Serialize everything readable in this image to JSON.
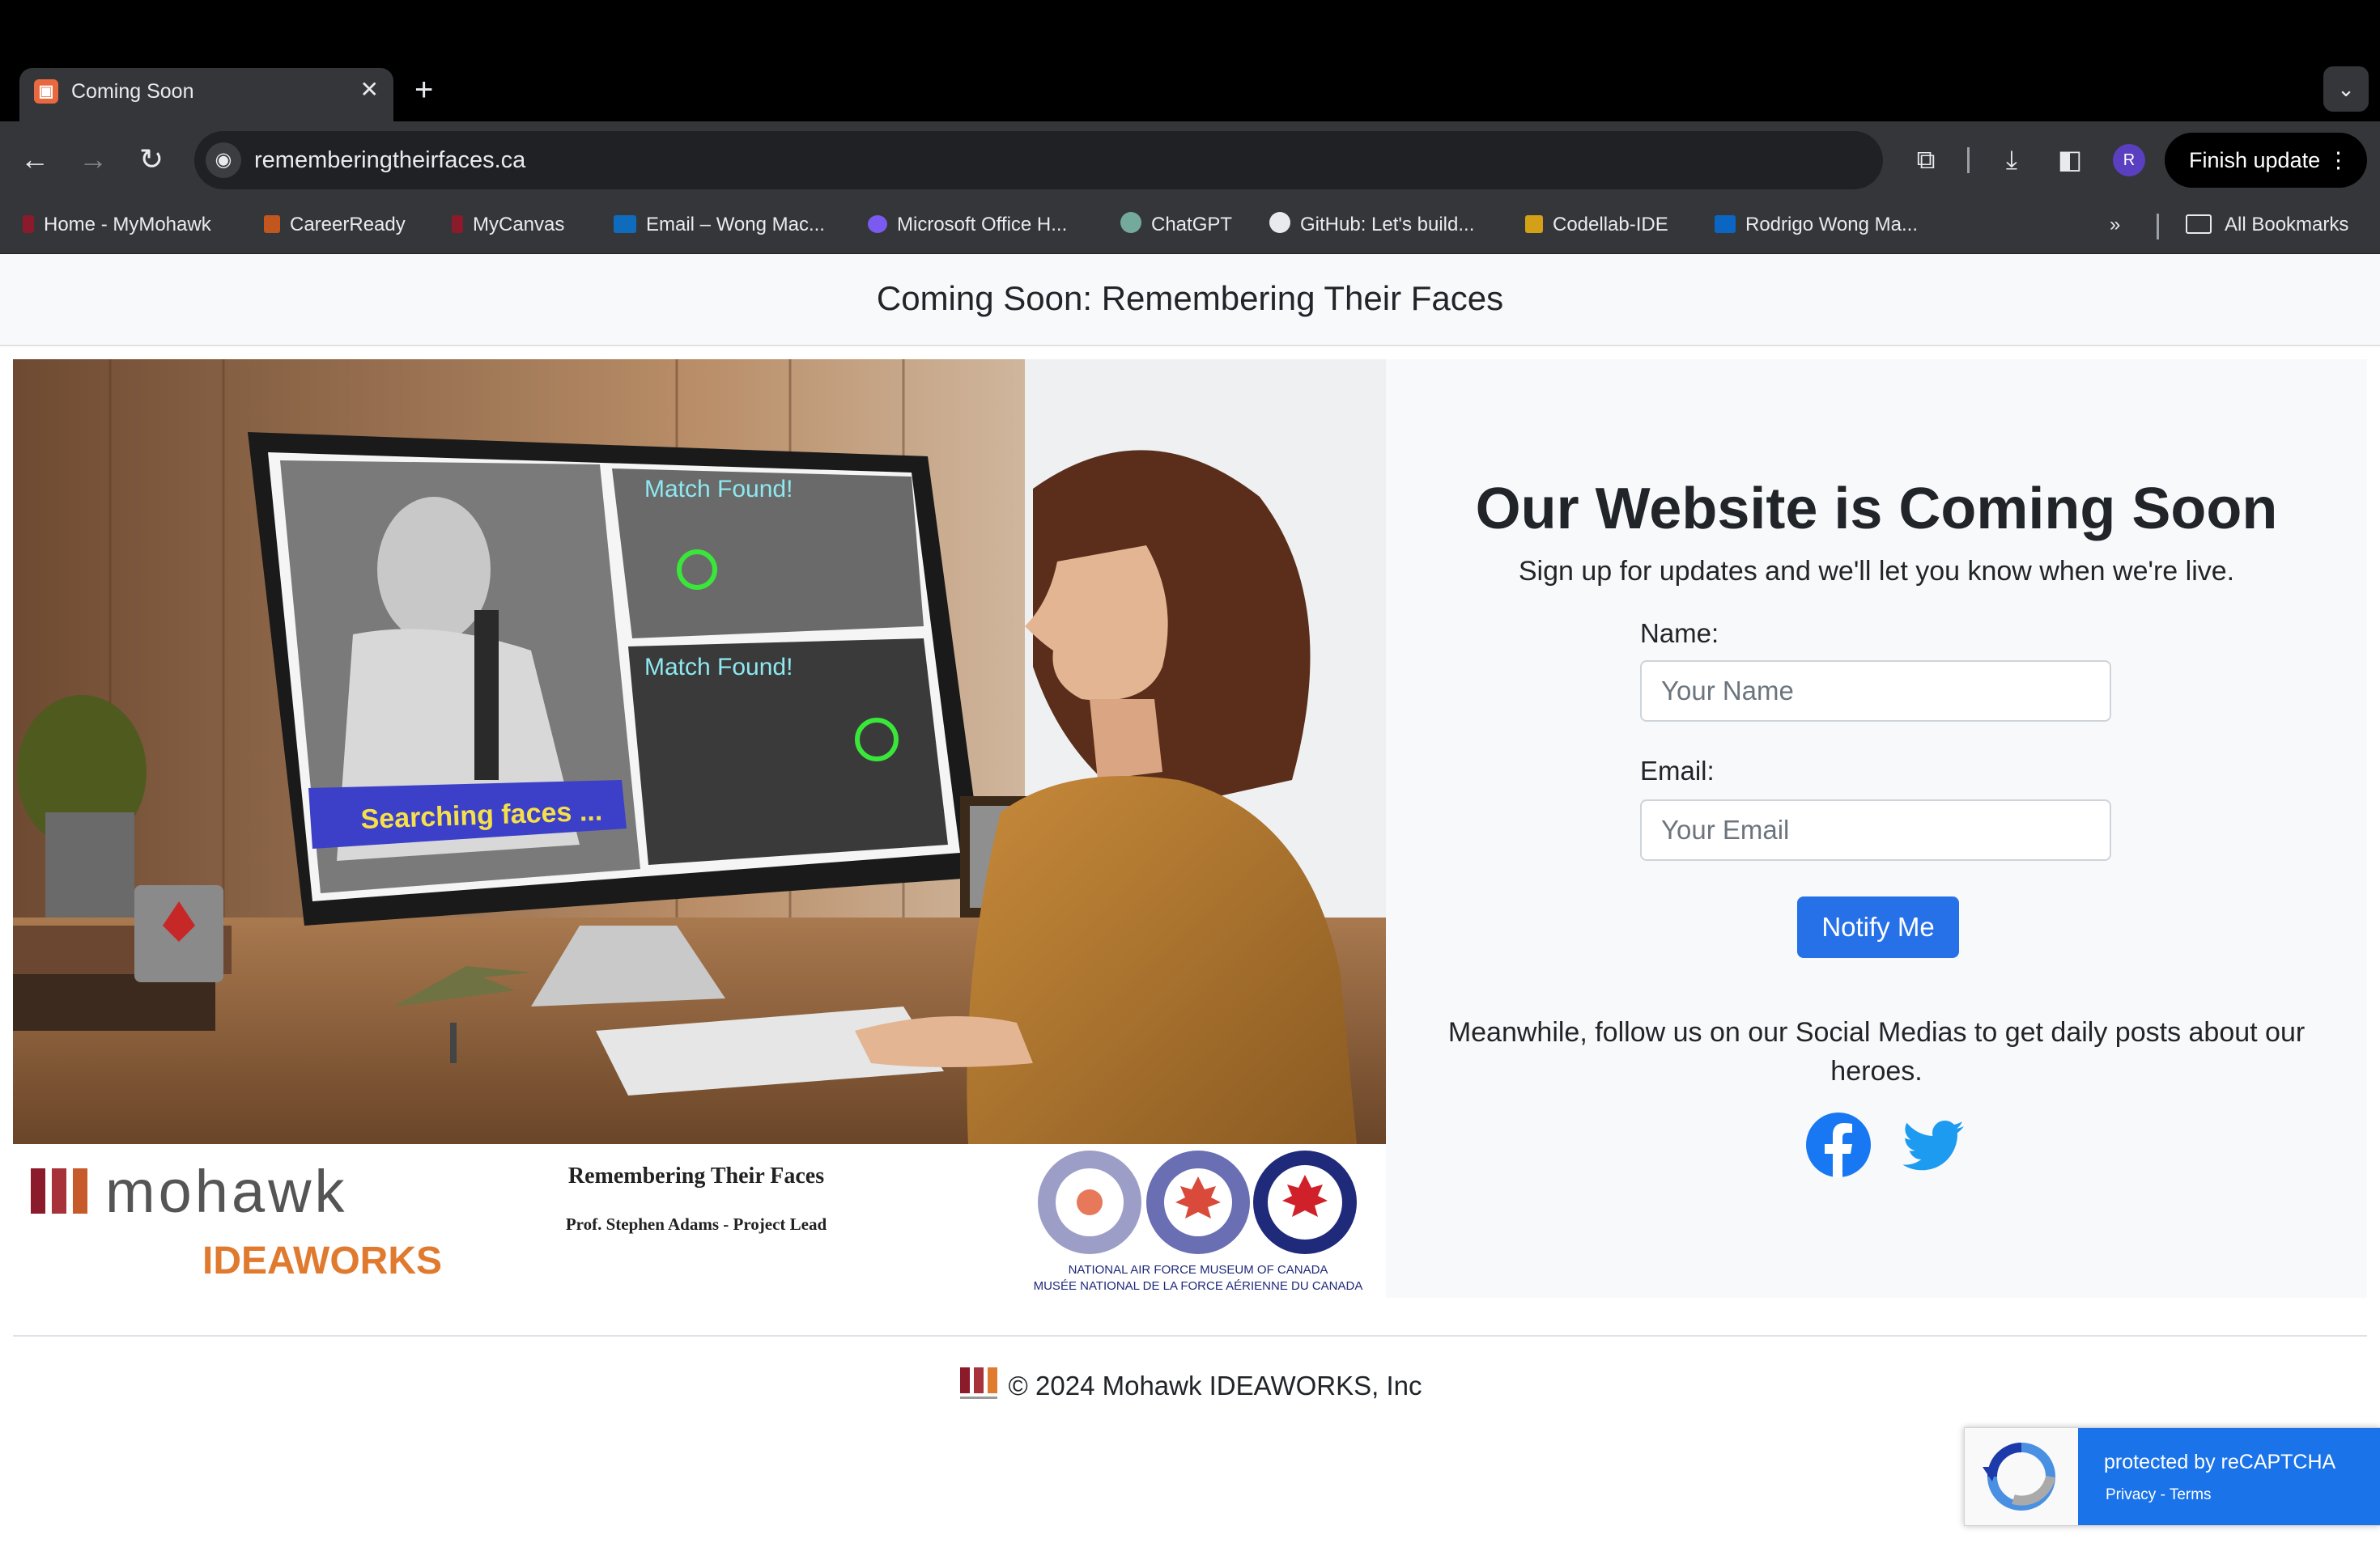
{
  "browser": {
    "tab_title": "Coming Soon",
    "url": "rememberingtheirfaces.ca",
    "finish_update": "Finish update",
    "profile_initial": "R",
    "bookmarks": [
      {
        "label": "Home - MyMohawk",
        "color": "#8b1a2b"
      },
      {
        "label": "CareerReady",
        "color": "#c2561f"
      },
      {
        "label": "MyCanvas",
        "color": "#8b1a2b"
      },
      {
        "label": "Email – Wong Mac...",
        "color": "#0f6cbd"
      },
      {
        "label": "Microsoft Office H...",
        "color": "#7a5af0"
      },
      {
        "label": "ChatGPT",
        "color": "#74aa9c"
      },
      {
        "label": "GitHub: Let's build...",
        "color": "#e8eaed"
      },
      {
        "label": "Codellab-IDE",
        "color": "#d4a017"
      },
      {
        "label": "Rodrigo Wong Ma...",
        "color": "#0a66c2"
      }
    ],
    "all_bookmarks": "All Bookmarks"
  },
  "page": {
    "header_title": "Coming Soon: Remembering Their Faces",
    "hero": {
      "monitor_label_1": "Match Found!",
      "monitor_label_2": "Match Found!",
      "search_banner": "Searching faces ..."
    },
    "logos": {
      "mohawk": "mohawk",
      "ideaworks": "IDEAWORKS",
      "project_title": "Remembering Their Faces",
      "project_lead": "Prof. Stephen Adams - Project Lead",
      "museum_en": "NATIONAL AIR FORCE MUSEUM OF CANADA",
      "museum_fr": "MUSÉE NATIONAL DE LA FORCE AÉRIENNE DU CANADA"
    },
    "form": {
      "heading": "Our Website is Coming Soon",
      "subheading": "Sign up for updates and we'll let you know when we're live.",
      "name_label": "Name:",
      "name_placeholder": "Your Name",
      "email_label": "Email:",
      "email_placeholder": "Your Email",
      "submit_label": "Notify Me",
      "follow_text": "Meanwhile, follow us on our Social Medias to get daily posts about our heroes."
    },
    "footer": "© 2024 Mohawk IDEAWORKS, Inc",
    "recaptcha": {
      "title": "protected by reCAPTCHA",
      "links": "Privacy - Terms"
    }
  },
  "colors": {
    "primary_button": "#2671e8",
    "facebook": "#1877f2",
    "twitter": "#1d9bf0",
    "mohawk_red": "#8b1a2b",
    "ideaworks_orange": "#e07a2e"
  }
}
